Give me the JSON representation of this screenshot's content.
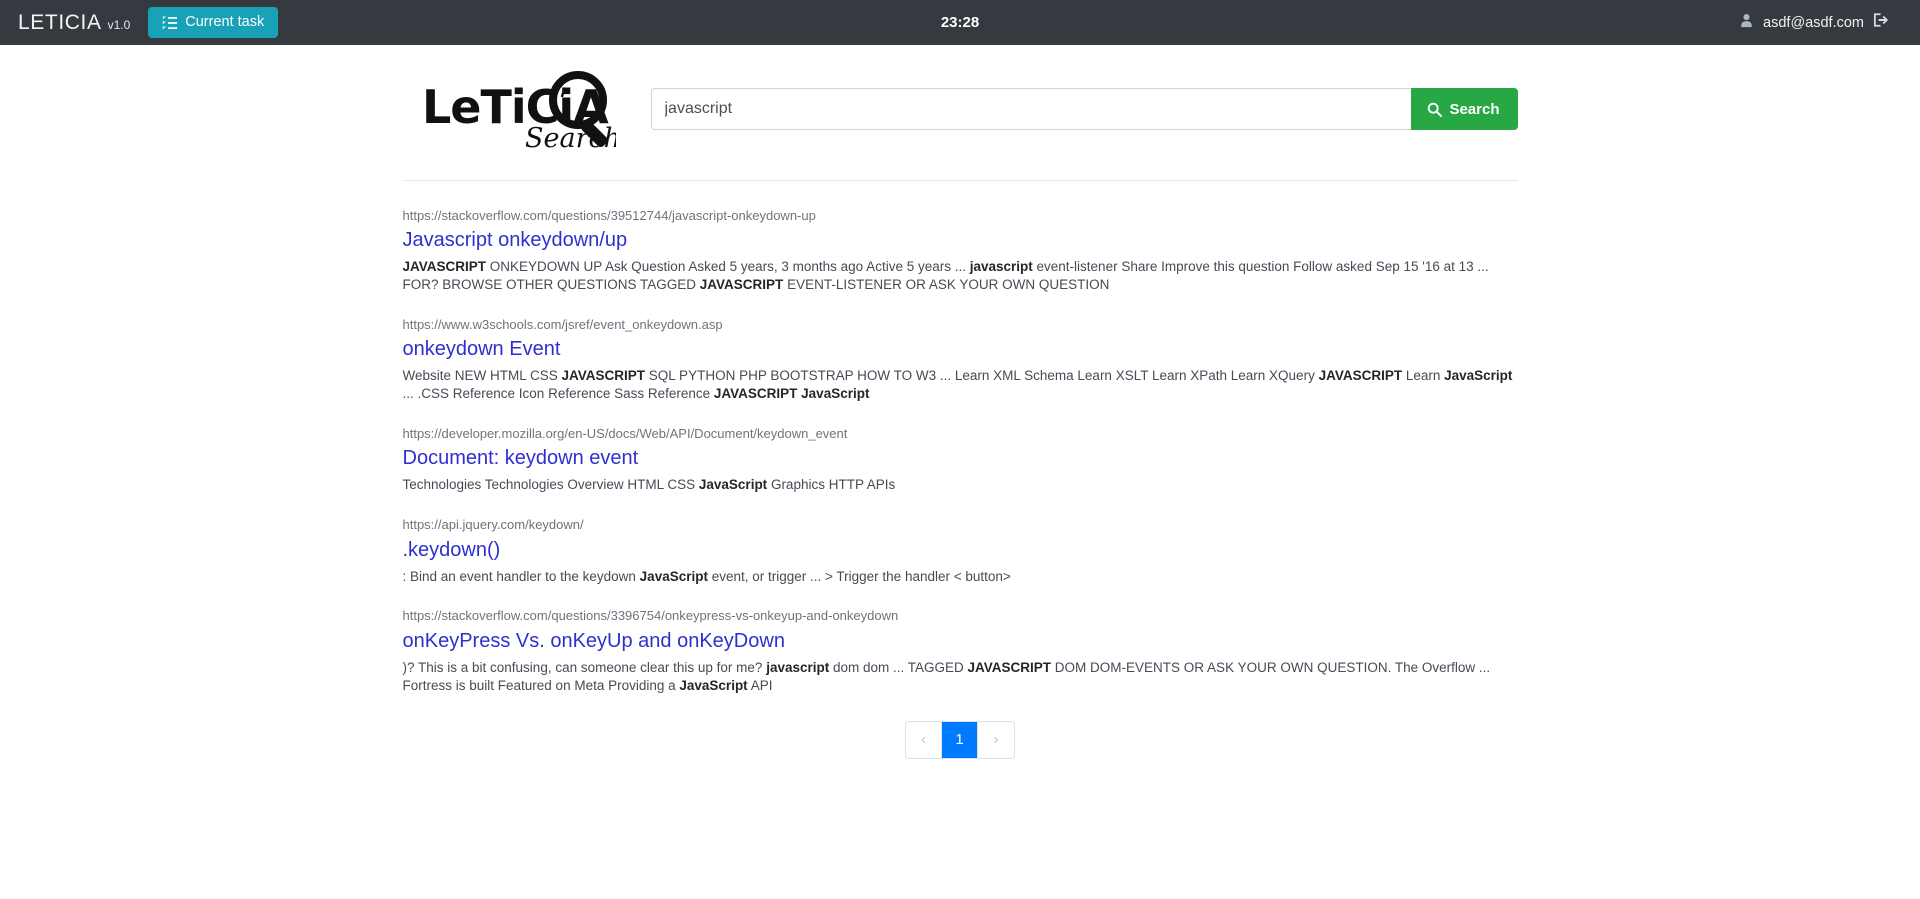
{
  "navbar": {
    "brand_name": "LETICIA",
    "brand_version": "v1.0",
    "task_button_label": "Current task",
    "clock": "23:28",
    "user_email": "asdf@asdf.com",
    "accent_task_color": "#17a2b8",
    "background_color": "#343a40"
  },
  "logo": {
    "wordmark": "LeTiCiA",
    "subtext": "Search"
  },
  "search": {
    "value": "javascript",
    "placeholder": "",
    "button_label": "Search",
    "button_color": "#28a745"
  },
  "results": [
    {
      "url": "https://stackoverflow.com/questions/39512744/javascript-onkeydown-up",
      "title": "Javascript onkeydown/up",
      "snippet_html": "<b>JAVASCRIPT</b> ONKEYDOWN UP Ask Question Asked 5 years, 3 months ago Active 5 years ... <b>javascript</b> event-listener Share Improve this question Follow asked Sep 15 '16 at 13 ... FOR? BROWSE OTHER QUESTIONS TAGGED <b>JAVASCRIPT</b> EVENT-LISTENER OR ASK YOUR OWN QUESTION"
    },
    {
      "url": "https://www.w3schools.com/jsref/event_onkeydown.asp",
      "title": "onkeydown Event",
      "snippet_html": "Website NEW HTML CSS <b>JAVASCRIPT</b> SQL PYTHON PHP BOOTSTRAP HOW TO W3 ... Learn XML Schema Learn XSLT Learn XPath Learn XQuery <b>JAVASCRIPT</b> Learn <b>JavaScript</b> ... .CSS Reference Icon Reference Sass Reference <b>JAVASCRIPT JavaScript</b>"
    },
    {
      "url": "https://developer.mozilla.org/en-US/docs/Web/API/Document/keydown_event",
      "title": "Document: keydown event",
      "snippet_html": "Technologies Technologies Overview HTML CSS <b>JavaScript</b> Graphics HTTP APIs"
    },
    {
      "url": "https://api.jquery.com/keydown/",
      "title": ".keydown()",
      "snippet_html": ": Bind an event handler to the keydown <b>JavaScript</b> event, or trigger ... > Trigger the handler &lt; button&gt;"
    },
    {
      "url": "https://stackoverflow.com/questions/3396754/onkeypress-vs-onkeyup-and-onkeydown",
      "title": "onKeyPress Vs. onKeyUp and onKeyDown",
      "snippet_html": ")? This is a bit confusing, can someone clear this up for me? <b>javascript</b> dom dom ... TAGGED <b>JAVASCRIPT</b> DOM DOM-EVENTS OR ASK YOUR OWN QUESTION. The Overflow ... Fortress is built Featured on Meta Providing a <b>JavaScript</b> API"
    }
  ],
  "pagination": {
    "prev_label": "‹",
    "next_label": "›",
    "pages": [
      "1"
    ],
    "active_page": "1",
    "active_color": "#007bff"
  }
}
